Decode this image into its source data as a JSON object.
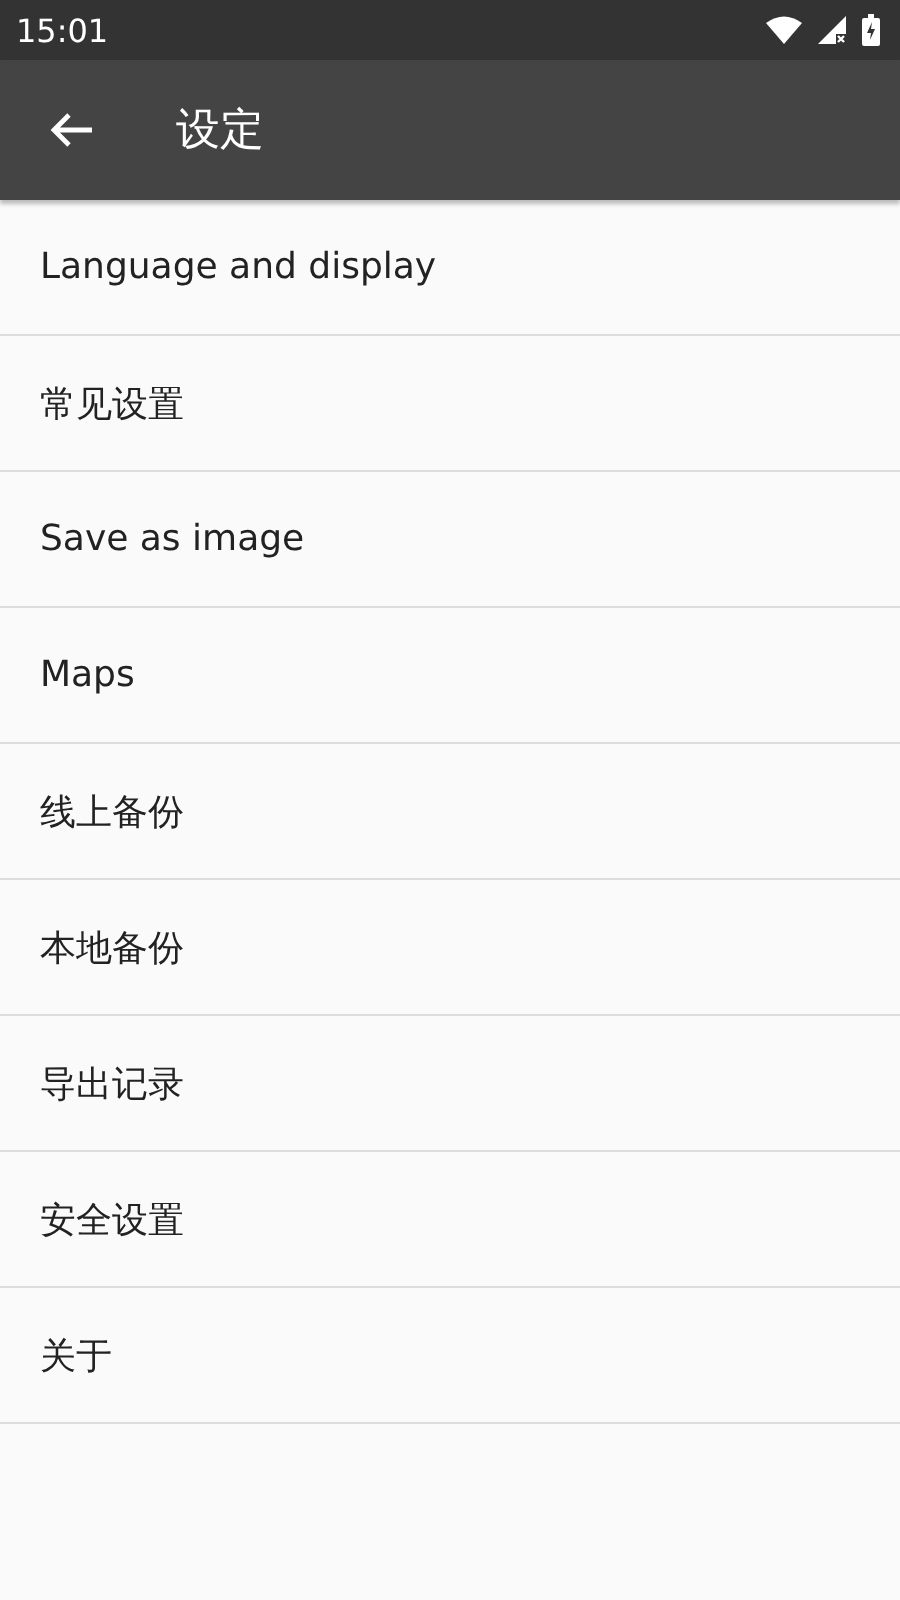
{
  "status_bar": {
    "time": "15:01"
  },
  "app_bar": {
    "title": "设定"
  },
  "settings": [
    {
      "label": "Language and display"
    },
    {
      "label": "常见设置"
    },
    {
      "label": "Save as image"
    },
    {
      "label": "Maps"
    },
    {
      "label": "线上备份"
    },
    {
      "label": "本地备份"
    },
    {
      "label": "导出记录"
    },
    {
      "label": "安全设置"
    },
    {
      "label": "关于"
    }
  ]
}
